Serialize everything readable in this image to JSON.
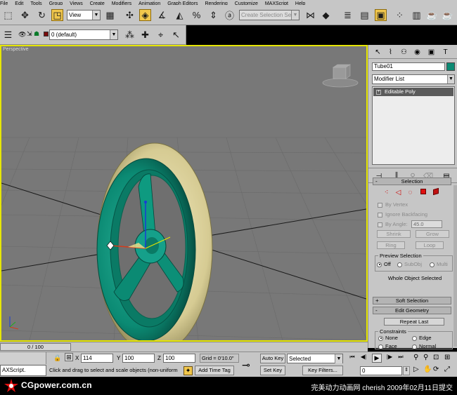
{
  "menubar": {
    "items": [
      "File",
      "Edit",
      "Tools",
      "Group",
      "Views",
      "Create",
      "Modifiers",
      "Animation",
      "Graph Editors",
      "Rendering",
      "Customize",
      "MAXScript",
      "Help"
    ]
  },
  "main_toolbar": {
    "view_dropdown": "View",
    "selection_set_placeholder": "Create Selection Se",
    "selected_tool_accent": "#f1c74d"
  },
  "layer_toolbar": {
    "layer_name": "0 (default)"
  },
  "viewport": {
    "label": "Perspective",
    "active_border_color": "#e6e600",
    "background_color": "#787878",
    "tire_color": "#d9cf9b",
    "rim_color": "#0b8a73"
  },
  "command_panel": {
    "object_name": "Tube01",
    "object_color": "#0b8a73",
    "modifier_list": "Modifier List",
    "stack_items": [
      "Editable Poly"
    ],
    "selection_rollout": {
      "title": "Selection",
      "by_vertex": "By Vertex",
      "ignore_backfacing": "Ignore Backfacing",
      "by_angle": "By Angle:",
      "angle_value": "45.0",
      "shrink": "Shrink",
      "grow": "Grow",
      "ring": "Ring",
      "loop": "Loop",
      "preview_title": "Preview Selection",
      "preview_off": "Off",
      "preview_subobj": "SubObj",
      "preview_multi": "Multi",
      "status": "Whole Object Selected"
    },
    "soft_selection": "Soft Selection",
    "edit_geometry": "Edit Geometry",
    "repeat_last": "Repeat Last",
    "constraints_title": "Constraints",
    "constraint_none": "None",
    "constraint_edge": "Edge",
    "constraint_face": "Face",
    "constraint_normal": "Normal"
  },
  "timeslider": {
    "label": "0 / 100"
  },
  "statusbar": {
    "x_label": "X",
    "x_value": "114",
    "y_label": "Y",
    "y_value": "100",
    "z_label": "Z",
    "z_value": "100",
    "grid": "Grid = 0'10.0\"",
    "auto_key": "Auto Key",
    "set_key": "Set Key",
    "selected_dropdown": "Selected",
    "key_filters": "Key Filters...",
    "frame_value": "0",
    "listener": "AXScript.",
    "prompt": "Click and drag to select and scale objects (non-uniform",
    "add_time_tag": "Add Time Tag"
  },
  "footer": {
    "logo": "CGpower.com.cn",
    "credit": "完美动力动画网 cherish 2009年02月11日提交"
  }
}
